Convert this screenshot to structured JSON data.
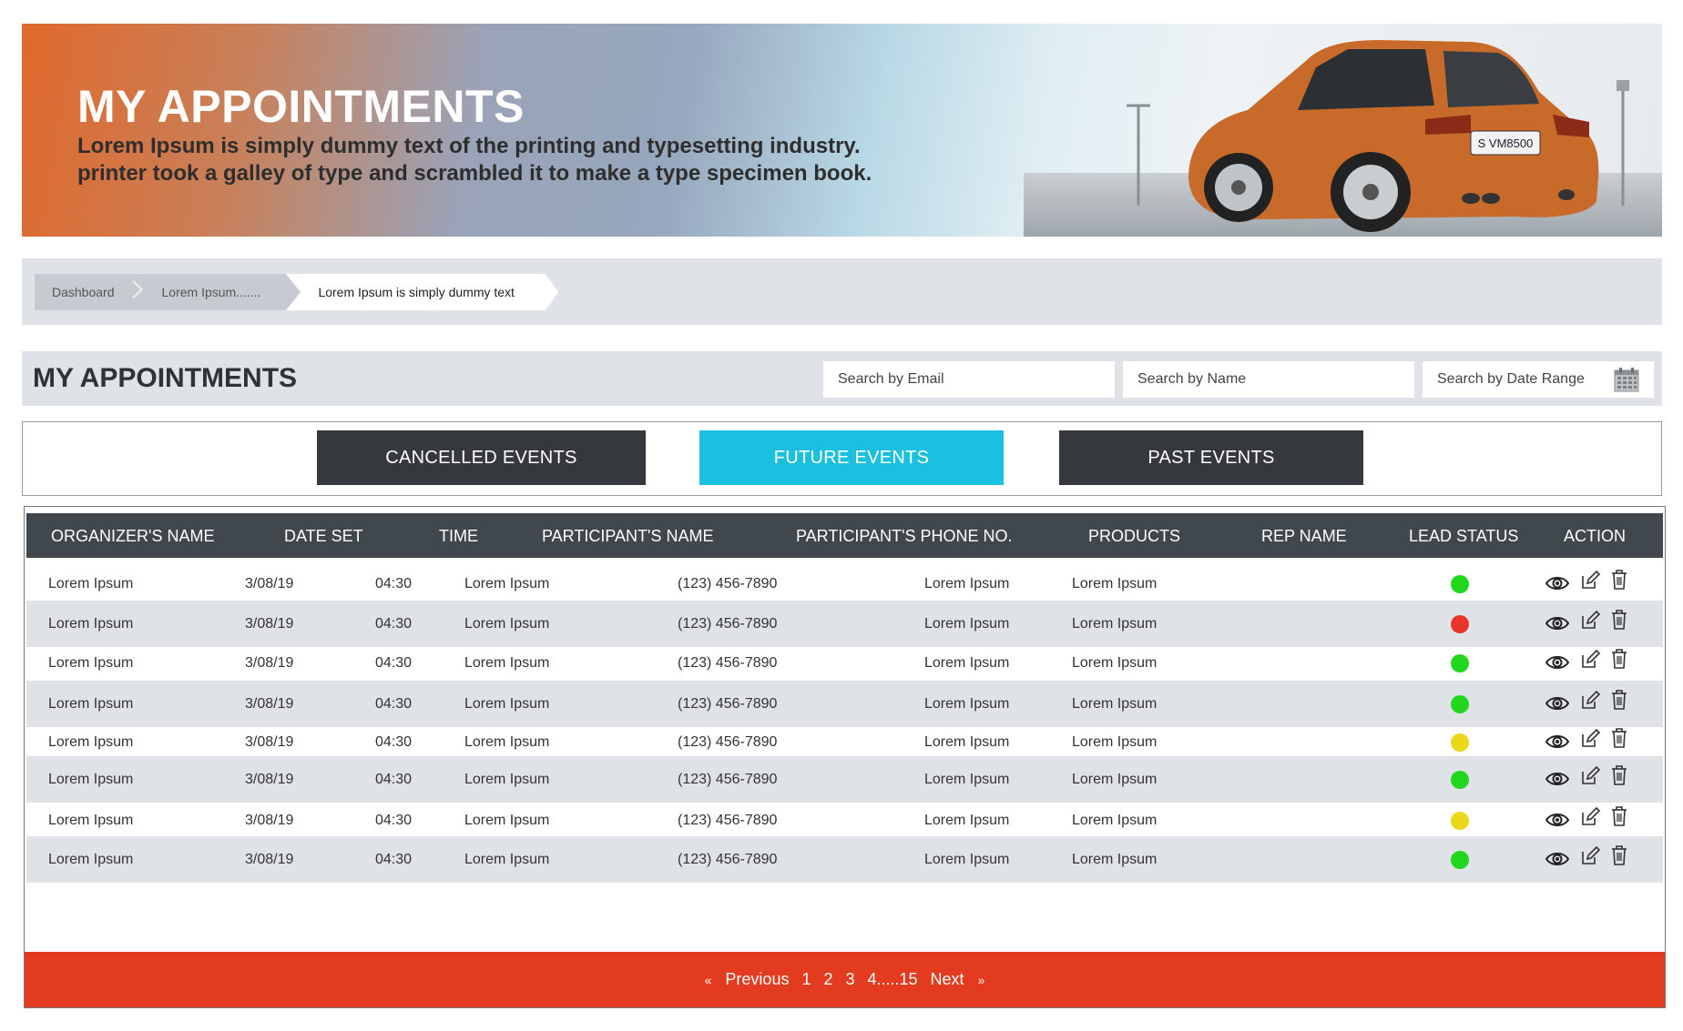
{
  "hero": {
    "title": "MY APPOINTMENTS",
    "subtitle_line1": "Lorem Ipsum is simply dummy text of the printing and typesetting industry.",
    "subtitle_line2": "printer took a galley of type and scrambled it to make a type specimen book.",
    "plate": "S VM8500"
  },
  "breadcrumb": {
    "items": [
      "Dashboard",
      "Lorem Ipsum.......",
      "Lorem Ipsum is simply dummy text"
    ]
  },
  "header": {
    "title": "MY APPOINTMENTS",
    "search_email": "Search by Email",
    "search_name": "Search by Name",
    "search_date": "Search by Date Range",
    "icons": {
      "date": "calendar-icon"
    }
  },
  "tabs": [
    {
      "label": "CANCELLED EVENTS",
      "active": false
    },
    {
      "label": "FUTURE EVENTS",
      "active": true
    },
    {
      "label": "PAST EVENTS",
      "active": false
    }
  ],
  "colors": {
    "accent": "#1bbfe0",
    "tab_dark": "#35393d",
    "header_bg": "#41484d",
    "pager_bg": "#e33b1f",
    "status_green": "#22d61e",
    "status_red": "#e8352c",
    "status_yellow": "#ecd81a"
  },
  "table": {
    "columns": [
      "ORGANIZER'S NAME",
      "DATE SET",
      "TIME",
      "PARTICIPANT'S NAME",
      "PARTICIPANT'S PHONE NO.",
      "PRODUCTS",
      "REP NAME",
      "LEAD STATUS",
      "ACTION"
    ],
    "rows": [
      {
        "organizer": "Lorem Ipsum",
        "date": "3/08/19",
        "time": "04:30",
        "participant": "Lorem Ipsum",
        "phone": "(123) 456-7890",
        "products": "Lorem Ipsum",
        "rep": "Lorem Ipsum",
        "status": "green"
      },
      {
        "organizer": "Lorem Ipsum",
        "date": "3/08/19",
        "time": "04:30",
        "participant": "Lorem Ipsum",
        "phone": "(123) 456-7890",
        "products": "Lorem Ipsum",
        "rep": "Lorem Ipsum",
        "status": "red"
      },
      {
        "organizer": "Lorem Ipsum",
        "date": "3/08/19",
        "time": "04:30",
        "participant": "Lorem Ipsum",
        "phone": "(123) 456-7890",
        "products": "Lorem Ipsum",
        "rep": "Lorem Ipsum",
        "status": "green"
      },
      {
        "organizer": "Lorem Ipsum",
        "date": "3/08/19",
        "time": "04:30",
        "participant": "Lorem Ipsum",
        "phone": "(123) 456-7890",
        "products": "Lorem Ipsum",
        "rep": "Lorem Ipsum",
        "status": "green"
      },
      {
        "organizer": "Lorem Ipsum",
        "date": "3/08/19",
        "time": "04:30",
        "participant": "Lorem Ipsum",
        "phone": "(123) 456-7890",
        "products": "Lorem Ipsum",
        "rep": "Lorem Ipsum",
        "status": "yellow"
      },
      {
        "organizer": "Lorem Ipsum",
        "date": "3/08/19",
        "time": "04:30",
        "participant": "Lorem Ipsum",
        "phone": "(123) 456-7890",
        "products": "Lorem Ipsum",
        "rep": "Lorem Ipsum",
        "status": "green"
      },
      {
        "organizer": "Lorem Ipsum",
        "date": "3/08/19",
        "time": "04:30",
        "participant": "Lorem Ipsum",
        "phone": "(123) 456-7890",
        "products": "Lorem Ipsum",
        "rep": "Lorem Ipsum",
        "status": "yellow"
      },
      {
        "organizer": "Lorem Ipsum",
        "date": "3/08/19",
        "time": "04:30",
        "participant": "Lorem Ipsum",
        "phone": "(123) 456-7890",
        "products": "Lorem Ipsum",
        "rep": "Lorem Ipsum",
        "status": "green"
      }
    ],
    "action_icons": [
      "eye-icon",
      "edit-icon",
      "trash-icon"
    ]
  },
  "pagination": {
    "prev_icon": "«",
    "previous": "Previous",
    "pages": [
      "1",
      "2",
      "3",
      "4.....15"
    ],
    "next": "Next",
    "next_icon": "»"
  }
}
